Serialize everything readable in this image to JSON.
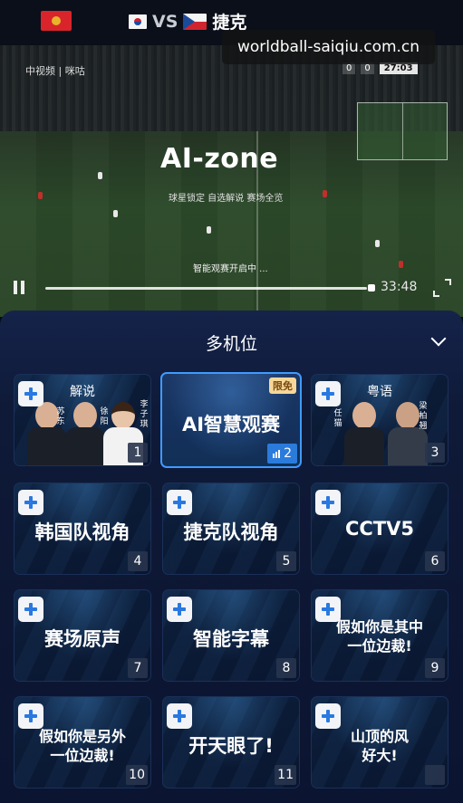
{
  "header": {
    "left_flag_icon": "flag-icon",
    "team_a_flag_icon": "korea-flag-icon",
    "vs": "VS",
    "team_b_flag_icon": "czech-flag-icon",
    "team_b": "捷克"
  },
  "watermark": "worldball-saiqiu.com.cn",
  "video": {
    "broadcaster": "中视频 | 咪咕",
    "score_a": "0",
    "score_b": "0",
    "clock": "27:03",
    "ai_title": "AI-zone",
    "ai_subtitle": "球星锁定  自选解说  赛场全览",
    "status": "智能观赛开启中 ...",
    "progress": 0.98,
    "time": "33:48"
  },
  "panel": {
    "title": "多机位",
    "tiles": [
      {
        "label": "解说",
        "num": "1",
        "kind": "commentary",
        "names": [
          "苏东",
          "徐阳",
          "李子琪"
        ]
      },
      {
        "label": "AI智慧观赛",
        "num": "2",
        "kind": "selected",
        "badge": "限免"
      },
      {
        "label": "粤语",
        "num": "3",
        "kind": "commentary",
        "names": [
          "任猫",
          "梁柏翘"
        ]
      },
      {
        "label": "韩国队视角",
        "num": "4"
      },
      {
        "label": "捷克队视角",
        "num": "5"
      },
      {
        "label": "CCTV5",
        "num": "6"
      },
      {
        "label": "赛场原声",
        "num": "7"
      },
      {
        "label": "智能字幕",
        "num": "8"
      },
      {
        "label_line1": "假如你是其中",
        "label_line2": "一位边裁!",
        "num": "9"
      },
      {
        "label_line1": "假如你是另外",
        "label_line2": "一位边裁!",
        "num": "10"
      },
      {
        "label": "开天眼了!",
        "num": "11"
      },
      {
        "label_line1": "山顶的风",
        "label_line2": "好大!",
        "num": ""
      }
    ]
  }
}
